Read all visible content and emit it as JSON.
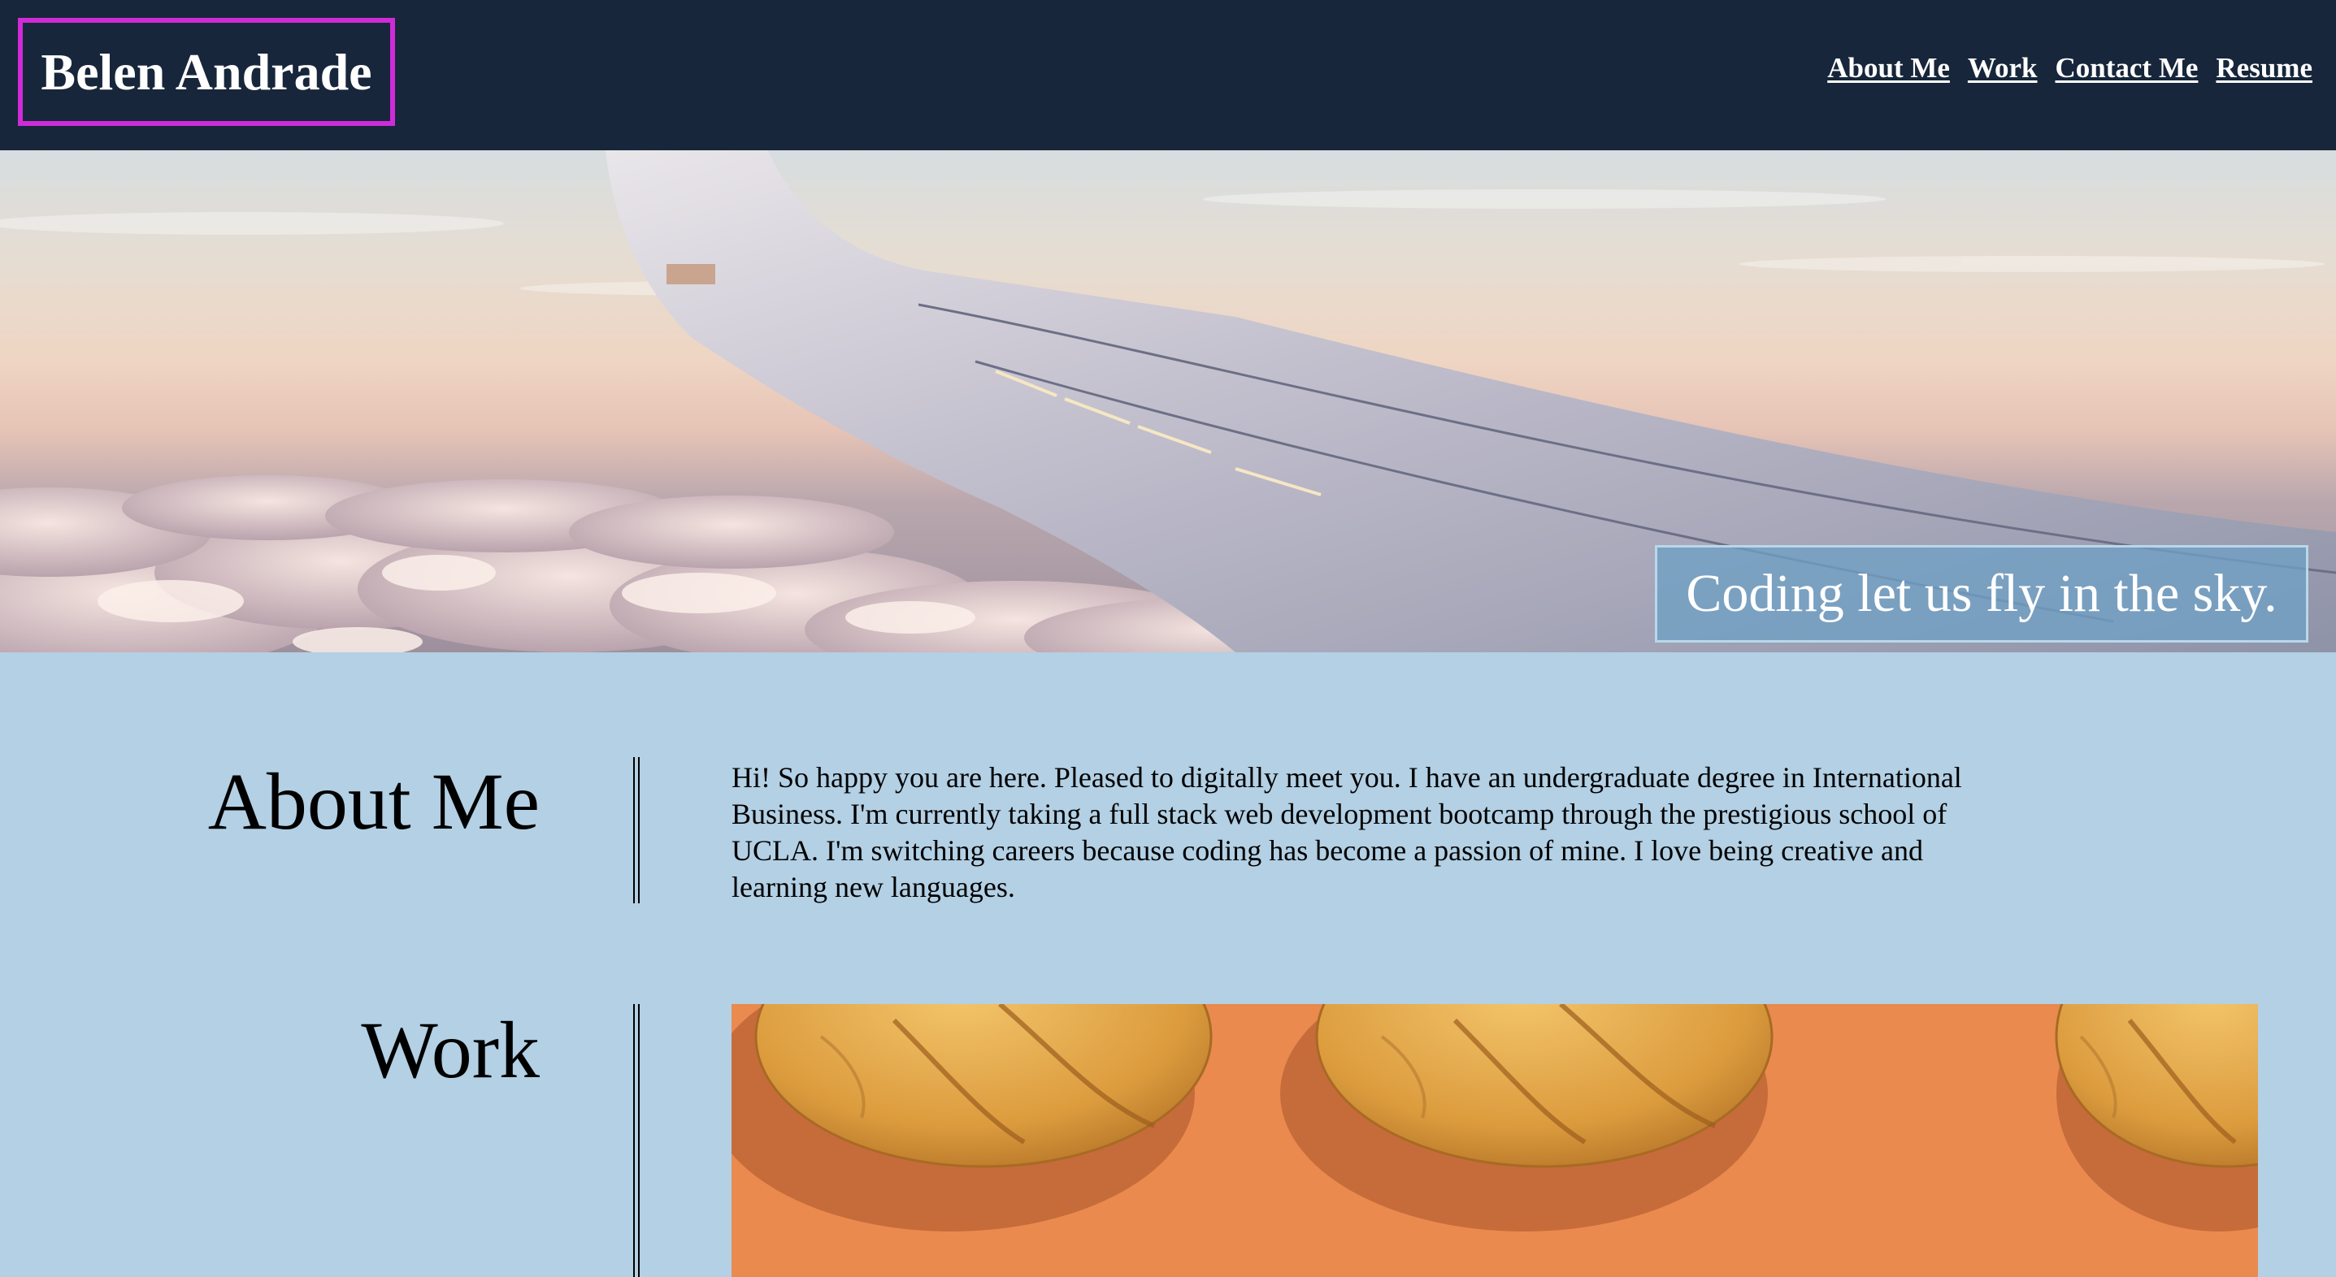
{
  "header": {
    "brand": "Belen Andrade",
    "nav": [
      {
        "label": "About Me"
      },
      {
        "label": "Work"
      },
      {
        "label": "Contact Me"
      },
      {
        "label": "Resume"
      }
    ]
  },
  "hero": {
    "caption": "Coding let us fly in the sky."
  },
  "about": {
    "title": "About Me",
    "text": "Hi! So happy you are here. Pleased to digitally meet you. I have an undergraduate degree in International Business. I'm currently taking a full stack web development bootcamp through the prestigious school of UCLA. I'm switching careers because coding has become a passion of mine. I love being creative and learning new languages."
  },
  "work": {
    "title": "Work"
  },
  "colors": {
    "header_bg": "#17263a",
    "brand_border": "#d02bd8",
    "page_bg": "#b3d0e4",
    "caption_bg": "#70a0c4",
    "work_bg": "#ea8a4e"
  }
}
